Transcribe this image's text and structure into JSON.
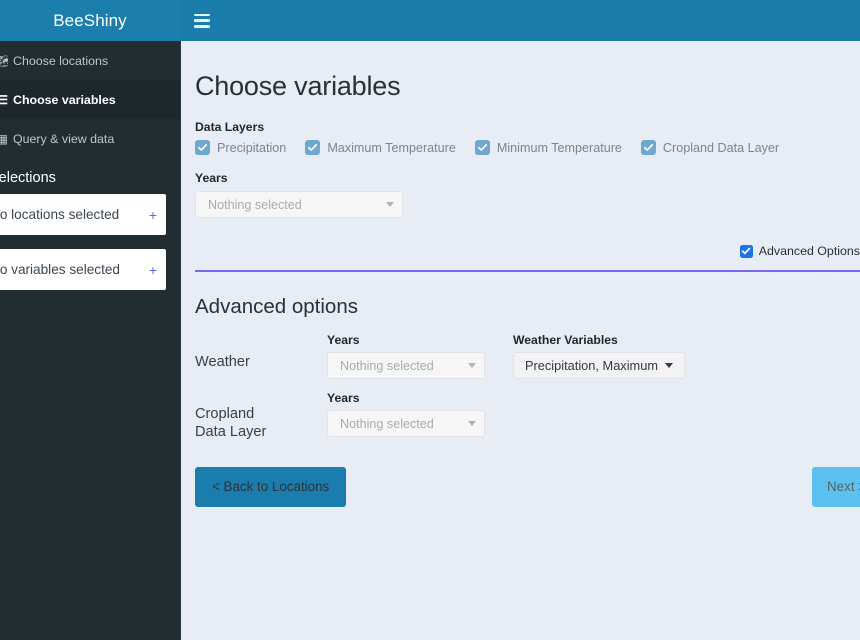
{
  "app": {
    "brand": "BeeShiny",
    "menu_icon": "hamburger-icon"
  },
  "sidebar": {
    "items": [
      {
        "label": "Choose locations",
        "icon": "map-icon",
        "active": false
      },
      {
        "label": "Choose variables",
        "icon": "layers-icon",
        "active": true
      },
      {
        "label": "Query & view data",
        "icon": "table-icon",
        "active": false
      }
    ],
    "selections_header": "Selections",
    "panels": [
      {
        "label": "No locations selected",
        "action": "+"
      },
      {
        "label": "No variables selected",
        "action": "+"
      }
    ]
  },
  "main": {
    "page_title": "Choose variables",
    "data_layers_label": "Data Layers",
    "data_layers": [
      {
        "label": "Precipitation",
        "checked": true
      },
      {
        "label": "Maximum Temperature",
        "checked": true
      },
      {
        "label": "Minimum Temperature",
        "checked": true
      },
      {
        "label": "Cropland Data Layer",
        "checked": true
      }
    ],
    "years_label": "Years",
    "years_value": "",
    "years_placeholder": "Nothing selected",
    "advanced_toggle_label": "Advanced Options",
    "advanced_toggle_checked": true,
    "advanced_title": "Advanced options",
    "weather_row_label": "Weather",
    "weather_years_label": "Years",
    "weather_years_placeholder": "Nothing selected",
    "weather_variables_label": "Weather Variables",
    "weather_variables_value": "Precipitation, Maximum",
    "cropland_row_label": "Cropland\nData Layer",
    "cropland_row_label_line1": "Cropland",
    "cropland_row_label_line2": "Data Layer",
    "cropland_years_label": "Years",
    "cropland_years_placeholder": "Nothing selected",
    "back_button": "< Back to Locations",
    "next_button": "Next >"
  },
  "colors": {
    "brand_blue": "#1b7ead",
    "sidebar_dark": "#222d32",
    "content_bg": "#e8ecf4",
    "accent_purple": "#7b68ee",
    "checkbox_muted": "#6fa7ce",
    "checkbox_active": "#1a73e8",
    "button_primary": "#1b7cae",
    "button_disabled": "#5bc2ef"
  }
}
